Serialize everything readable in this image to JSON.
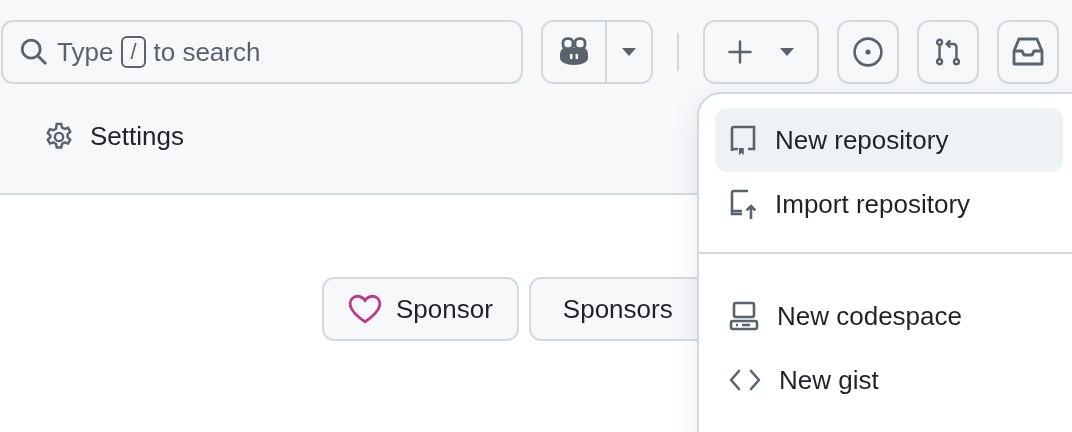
{
  "search": {
    "placeholder_before": "Type",
    "key": "/",
    "placeholder_after": "to search"
  },
  "tabs": [
    {
      "label": "Settings",
      "selected": false
    }
  ],
  "sponsor_buttons": [
    {
      "label": "Sponsor",
      "kind": "heart"
    },
    {
      "label": "Sponsors",
      "kind": "plain"
    }
  ],
  "create_menu": {
    "sections": [
      [
        {
          "label": "New repository",
          "kind": "repo",
          "selected": true
        },
        {
          "label": "Import repository",
          "kind": "import",
          "selected": false
        }
      ],
      [
        {
          "label": "New codespace",
          "kind": "codespace",
          "selected": false
        },
        {
          "label": "New gist",
          "kind": "code",
          "selected": false
        }
      ]
    ]
  }
}
